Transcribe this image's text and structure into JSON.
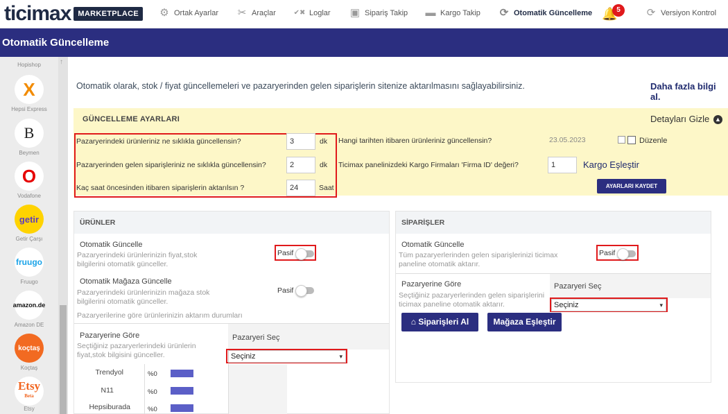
{
  "brand": {
    "logo_text": "ticimax",
    "badge": "MARKETPLACE"
  },
  "nav": {
    "items": [
      {
        "label": "Ortak Ayarlar",
        "icon": "gear-icon"
      },
      {
        "label": "Araçlar",
        "icon": "tools-icon"
      },
      {
        "label": "Loglar",
        "icon": "log-icon"
      },
      {
        "label": "Sipariş Takip",
        "icon": "box-icon"
      },
      {
        "label": "Kargo Takip",
        "icon": "truck-icon"
      },
      {
        "label": "Otomatik Güncelleme",
        "icon": "refresh-icon",
        "active": true
      },
      {
        "label": "Versiyon Kontrol",
        "icon": "refresh-icon"
      }
    ],
    "notification_count": "5"
  },
  "page_title": "Otomatik Güncelleme",
  "sidebar": {
    "items": [
      {
        "label": "Hopishop"
      },
      {
        "label": "Hepsi Express",
        "mark": "X"
      },
      {
        "label": "Beymen",
        "mark": "B"
      },
      {
        "label": "Vodafone",
        "mark": "O"
      },
      {
        "label": "Getir Çarşı",
        "mark": "getir"
      },
      {
        "label": "Fruugo",
        "mark": "fruugo"
      },
      {
        "label": "Amazon DE",
        "mark": "amazon.de"
      },
      {
        "label": "Koçtaş",
        "mark": "koçtaş"
      },
      {
        "label": "Etsy",
        "mark": "Etsy",
        "sub": "Beta"
      }
    ]
  },
  "intro_text": "Otomatik olarak, stok / fiyat güncellemeleri ve pazaryerinden gelen siparişlerin sitenize aktarılmasını sağlayabilirsiniz.",
  "more_info": "Daha fazla bilgi al.",
  "settings": {
    "heading": "GÜNCELLEME AYARLARI",
    "hide_label": "Detayları Gizle",
    "q1": "Pazaryerindeki ürünleriniz ne sıklıkla güncellensin?",
    "q1_value": "3",
    "q1_unit": "dk",
    "q2": "Pazaryerinden gelen siparişleriniz ne sıklıkla güncellensin?",
    "q2_value": "2",
    "q2_unit": "dk",
    "q3": "Kaç saat öncesinden itibaren siparişlerin aktarılsın ?",
    "q3_value": "24",
    "q3_unit": "Saat",
    "date_q": "Hangi tarihten itibaren ürünleriniz güncellensin?",
    "date_value": "23.05.2023",
    "edit_label": "Düzenle",
    "firm_q": "Ticimax panelinizdeki Kargo Firmaları 'Firma ID' değeri?",
    "firm_value": "1",
    "kargo_link": "Kargo Eşleştir",
    "save_button": "AYARLARI KAYDET"
  },
  "products": {
    "heading": "ÜRÜNLER",
    "auto_title": "Otomatik Güncelle",
    "auto_desc_1": "Pazaryerindeki ürünlerinizin fiyat,stok",
    "auto_desc_2": "bilgilerini otomatik günceller.",
    "auto_toggle": "Pasif",
    "store_title": "Otomatik Mağaza Güncelle",
    "store_desc_1": "Pazaryerindeki ürünlerinizin mağaza stok",
    "store_desc_2": "bilgilerini otomatik günceller.",
    "store_toggle": "Pasif",
    "status_caption": "Pazaryerilerine göre ürünlerinizin aktarım durumları",
    "by_mp_title": "Pazaryerine Göre",
    "by_mp_desc_1": "Seçtiğiniz pazaryerlerindeki ürünlerin",
    "by_mp_desc_2": "fiyat,stok bilgisini günceller.",
    "select_label": "Pazaryeri Seç",
    "select_value": "Seçiniz",
    "rows": [
      {
        "name": "Trendyol",
        "pct": "%0"
      },
      {
        "name": "N11",
        "pct": "%0"
      },
      {
        "name": "Hepsiburada",
        "pct": "%0"
      }
    ]
  },
  "orders": {
    "heading": "SİPARİŞLER",
    "auto_title": "Otomatik Güncelle",
    "auto_desc_1": "Tüm pazaryerlerinden gelen siparişlerinizi ticimax",
    "auto_desc_2": "paneline otomatik aktarır.",
    "auto_toggle": "Pasif",
    "by_mp_title": "Pazaryerine Göre",
    "by_mp_desc_1": "Seçtiğiniz pazaryerlerinden gelen siparişlerini",
    "by_mp_desc_2": "ticimax paneline otomatik aktarır.",
    "select_label": "Pazaryeri Seç",
    "select_value": "Seçiniz",
    "fetch_button": "Siparişleri Al",
    "match_button": "Mağaza Eşleştir"
  }
}
